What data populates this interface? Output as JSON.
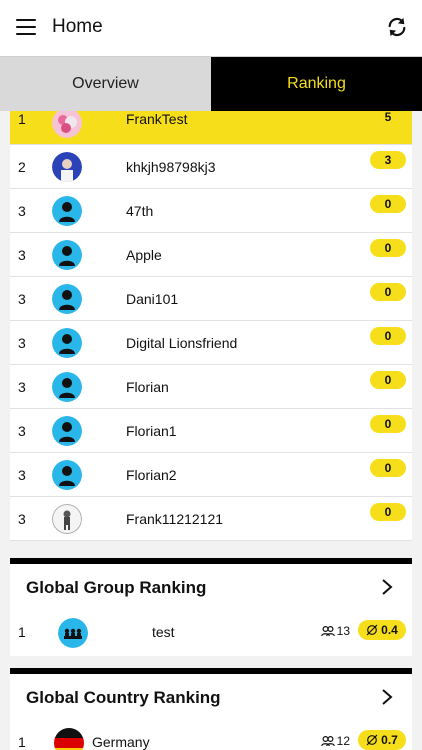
{
  "header": {
    "title": "Home",
    "menu_icon": "hamburger-menu-icon",
    "refresh_icon": "refresh-icon"
  },
  "tabs": [
    {
      "label": "Overview",
      "active": false
    },
    {
      "label": "Ranking",
      "active": true
    }
  ],
  "ranking": {
    "rows": [
      {
        "pos": "1",
        "name": "FrankTest",
        "points": "5",
        "avatar": "photo",
        "highlight": true
      },
      {
        "pos": "2",
        "name": "khkjh98798kj3",
        "points": "3",
        "avatar": "photo",
        "highlight": false
      },
      {
        "pos": "3",
        "name": "47th",
        "points": "0",
        "avatar": "default",
        "highlight": false
      },
      {
        "pos": "3",
        "name": "Apple",
        "points": "0",
        "avatar": "default",
        "highlight": false
      },
      {
        "pos": "3",
        "name": "Dani101",
        "points": "0",
        "avatar": "default",
        "highlight": false
      },
      {
        "pos": "3",
        "name": "Digital Lionsfriend",
        "points": "0",
        "avatar": "default",
        "highlight": false
      },
      {
        "pos": "3",
        "name": "Florian",
        "points": "0",
        "avatar": "default",
        "highlight": false
      },
      {
        "pos": "3",
        "name": "Florian1",
        "points": "0",
        "avatar": "default",
        "highlight": false
      },
      {
        "pos": "3",
        "name": "Florian2",
        "points": "0",
        "avatar": "default",
        "highlight": false
      },
      {
        "pos": "3",
        "name": "Frank11212121",
        "points": "0",
        "avatar": "photo-figure",
        "highlight": false
      }
    ]
  },
  "global_group": {
    "title": "Global Group Ranking",
    "row": {
      "pos": "1",
      "name": "test",
      "members": "13",
      "average": "0.4",
      "icon": "group-icon"
    }
  },
  "global_country": {
    "title": "Global Country Ranking",
    "row": {
      "pos": "1",
      "name": "Germany",
      "members": "12",
      "average": "0.7",
      "icon": "germany-flag-icon"
    }
  },
  "colors": {
    "accent": "#f6df1a",
    "avatar_blue": "#29b6e8",
    "black": "#000000"
  }
}
